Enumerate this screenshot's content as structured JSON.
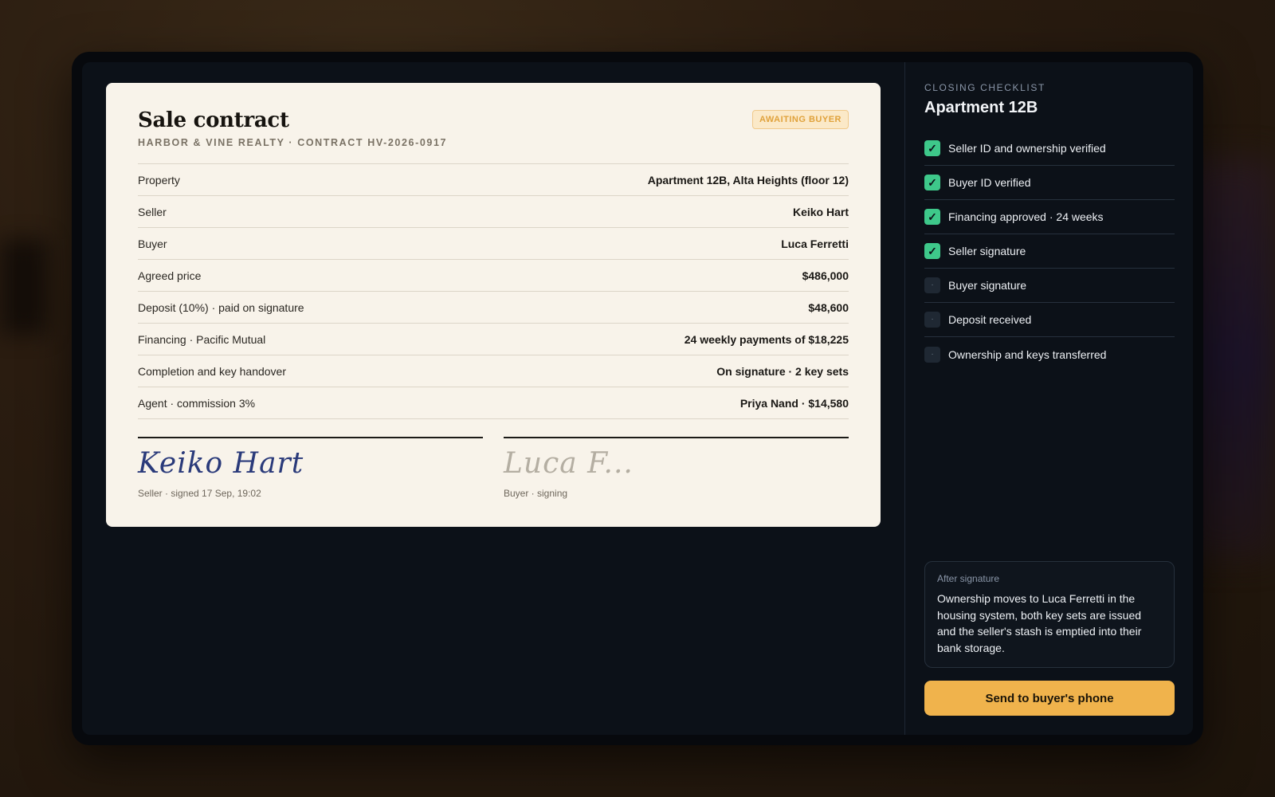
{
  "contract": {
    "title": "Sale contract",
    "subtitle": "HARBOR & VINE REALTY · CONTRACT HV-2026-0917",
    "status": "AWAITING BUYER",
    "rows": [
      {
        "label": "Property",
        "value": "Apartment 12B, Alta Heights (floor 12)"
      },
      {
        "label": "Seller",
        "value": "Keiko Hart"
      },
      {
        "label": "Buyer",
        "value": "Luca Ferretti"
      },
      {
        "label": "Agreed price",
        "value": "$486,000"
      },
      {
        "label": "Deposit (10%) · paid on signature",
        "value": "$48,600"
      },
      {
        "label": "Financing · Pacific Mutual",
        "value": "24 weekly payments of $18,225"
      },
      {
        "label": "Completion and key handover",
        "value": "On signature · 2 key sets"
      },
      {
        "label": "Agent · commission 3%",
        "value": "Priya Nand · $14,580"
      }
    ],
    "signatures": {
      "seller": {
        "name": "Keiko Hart",
        "meta": "Seller · signed 17 Sep, 19:02"
      },
      "buyer": {
        "name": "Luca F...",
        "meta": "Buyer · signing"
      }
    }
  },
  "checklist": {
    "eyebrow": "CLOSING CHECKLIST",
    "title": "Apartment 12B",
    "items": [
      {
        "label": "Seller ID and ownership verified",
        "done": true
      },
      {
        "label": "Buyer ID verified",
        "done": true
      },
      {
        "label": "Financing approved · 24 weeks",
        "done": true
      },
      {
        "label": "Seller signature",
        "done": true
      },
      {
        "label": "Buyer signature",
        "done": false
      },
      {
        "label": "Deposit received",
        "done": false
      },
      {
        "label": "Ownership and keys transferred",
        "done": false
      }
    ],
    "icons": {
      "done": "✓",
      "todo": "·"
    }
  },
  "after": {
    "label": "After signature",
    "text": "Ownership moves to Luca Ferretti in the housing system, both key sets are issued and the seller's stash is emptied into their bank storage."
  },
  "cta": {
    "label": "Send to buyer's phone"
  },
  "colors": {
    "accent": "#f0b34c",
    "done": "#3ec88a",
    "badge": "#e0a23c"
  }
}
